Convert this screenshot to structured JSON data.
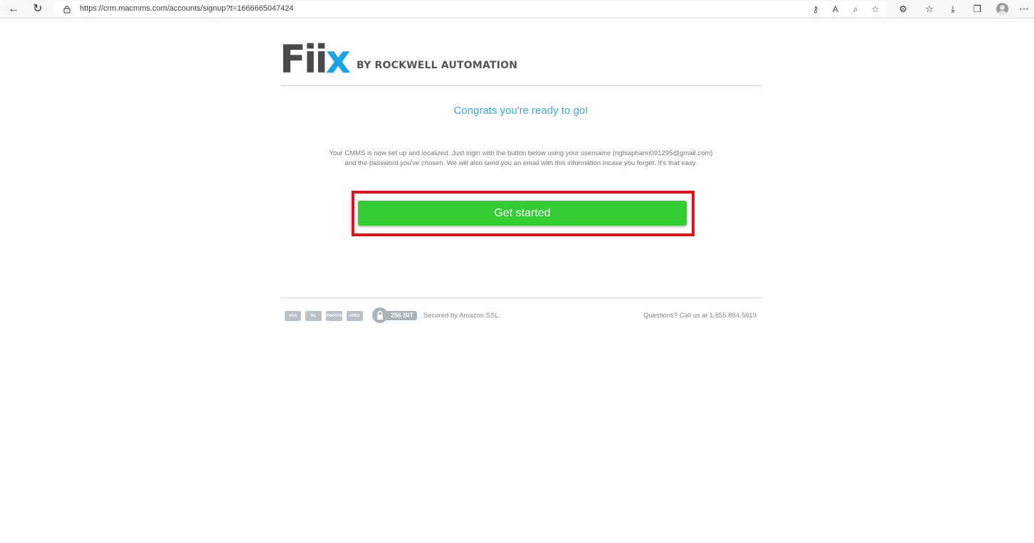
{
  "browser": {
    "url": "https://crm.macmms.com/accounts/signup?t=1666665047424",
    "back_icon": "arrow-left-icon",
    "refresh_icon": "refresh-icon"
  },
  "logo": {
    "wordmark_main": "Fii",
    "wordmark_accent": "x",
    "tagline": "BY ROCKWELL AUTOMATION",
    "accent_color": "#1aa3e6"
  },
  "content": {
    "headline": "Congrats you're ready to go!",
    "body": "Your CMMS is now set up and localized. Just login with the button below using your username (nghiaphann091295@gmail.com) and the password you've chosen. We will also send you an email with this information incase you forget. It's that easy.",
    "cta_label": "Get started",
    "cta_color": "#33cc33",
    "highlight_color": "#d9161f"
  },
  "footer": {
    "cards": [
      "VISA",
      "MC",
      "DISCOVER",
      "AMEX"
    ],
    "ssl_badge": "256 BIT",
    "ssl_text": "Secured by Amazon SSL",
    "support_text": "Questions? Call us at 1.855.884.5619"
  }
}
